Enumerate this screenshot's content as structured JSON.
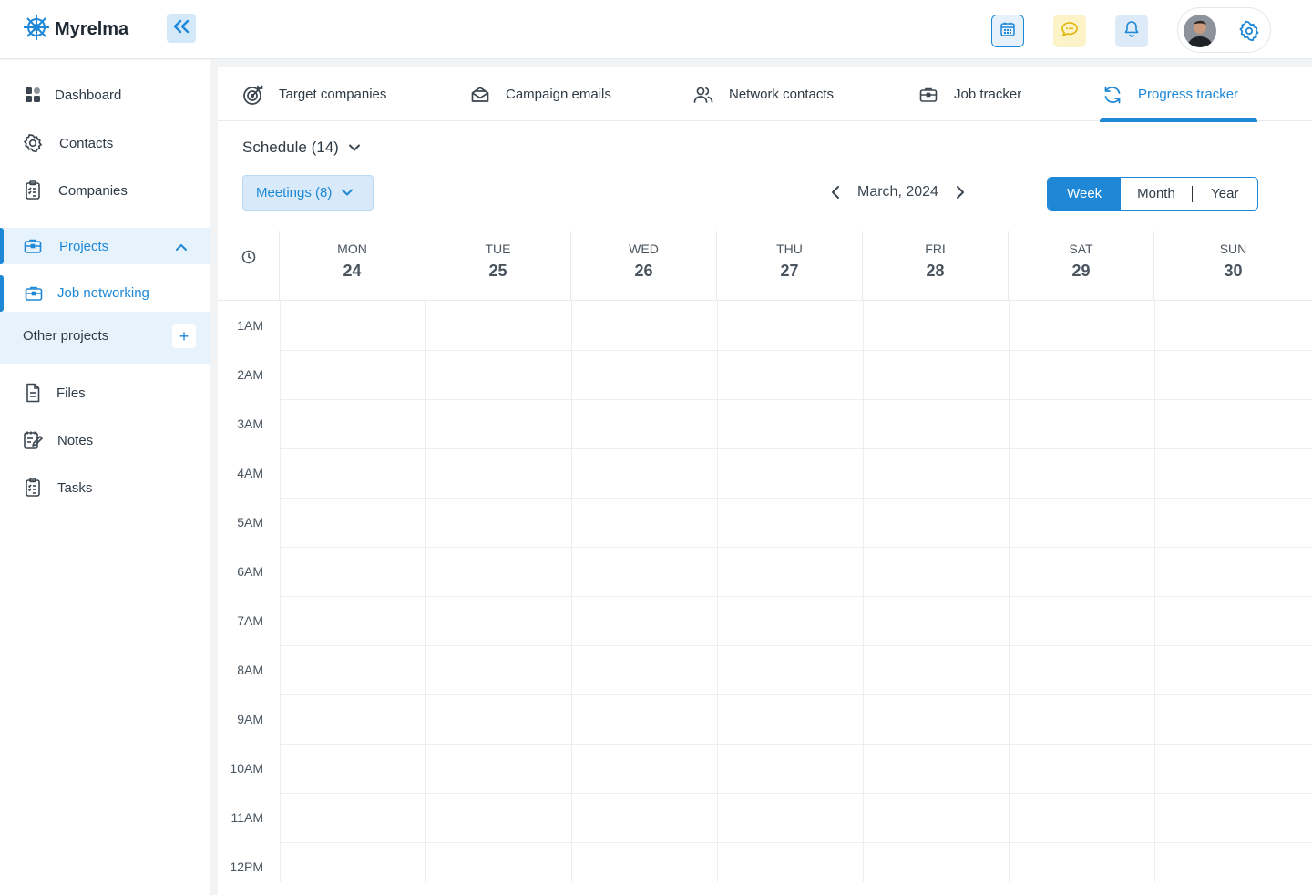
{
  "app": {
    "name": "Myrelma"
  },
  "sidebar": {
    "items": [
      {
        "label": "Dashboard"
      },
      {
        "label": "Contacts"
      },
      {
        "label": "Companies"
      },
      {
        "label": "Projects"
      },
      {
        "label": "Files"
      },
      {
        "label": "Notes"
      },
      {
        "label": "Tasks"
      }
    ],
    "sub": {
      "active_project": "Job networking",
      "other_projects": "Other projects",
      "add": "+"
    }
  },
  "tabs": [
    {
      "label": "Target companies"
    },
    {
      "label": "Campaign emails"
    },
    {
      "label": "Network contacts"
    },
    {
      "label": "Job tracker"
    },
    {
      "label": "Progress tracker",
      "active": true
    }
  ],
  "schedule": {
    "label": "Schedule (14)"
  },
  "filter": {
    "label": "Meetings (8)"
  },
  "calendar": {
    "period": "March, 2024",
    "views": [
      "Week",
      "Month",
      "Year"
    ],
    "active_view": "Week",
    "days": [
      {
        "name": "MON",
        "num": "24"
      },
      {
        "name": "TUE",
        "num": "25"
      },
      {
        "name": "WED",
        "num": "26"
      },
      {
        "name": "THU",
        "num": "27"
      },
      {
        "name": "FRI",
        "num": "28"
      },
      {
        "name": "SAT",
        "num": "29"
      },
      {
        "name": "SUN",
        "num": "30"
      }
    ],
    "hours": [
      "1AM",
      "2AM",
      "3AM",
      "4AM",
      "5AM",
      "6AM",
      "7AM",
      "8AM",
      "9AM",
      "10AM",
      "11AM",
      "12PM"
    ]
  },
  "colors": {
    "accent": "#1e88d6",
    "accent_light": "#e6f2fc",
    "chat_bg": "#fdf3c9",
    "chat_icon": "#e0b500"
  }
}
